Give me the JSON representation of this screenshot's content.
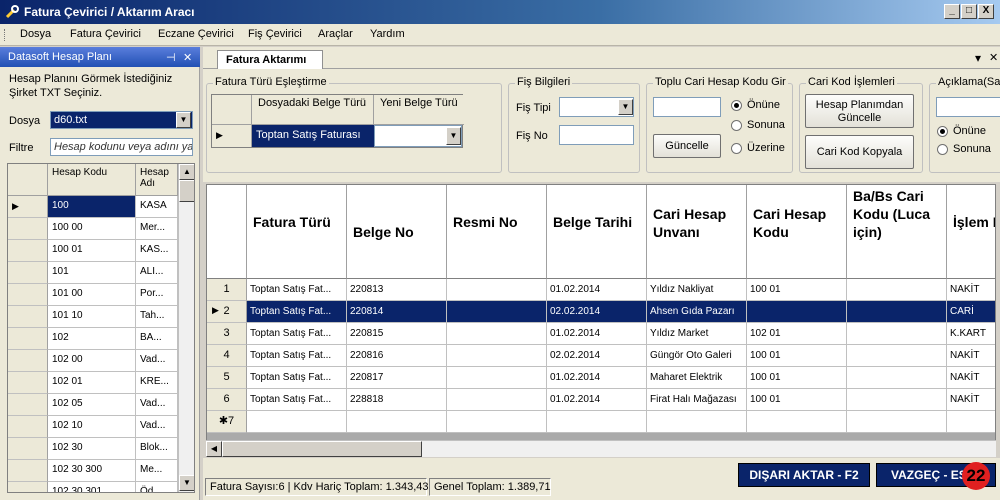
{
  "window": {
    "title": "Fatura Çevirici / Aktarım Aracı",
    "minimize": "_",
    "maximize": "□",
    "close": "X"
  },
  "menu": [
    "Dosya",
    "Fatura Çevirici",
    "Eczane Çevirici",
    "Fiş Çevirici",
    "Araçlar",
    "Yardım"
  ],
  "left_panel": {
    "title": "Datasoft Hesap Planı",
    "pin": "⊣",
    "close": "✕",
    "instruction_line1": "Hesap Planını Görmek İstediğiniz",
    "instruction_line2": "Şirket TXT Seçiniz.",
    "dosya_label": "Dosya",
    "dosya_value": "d60.txt",
    "filtre_label": "Filtre",
    "filtre_placeholder": "Hesap kodunu veya adını yaz",
    "grid_headers": [
      "Hesap Kodu",
      "Hesap Adı"
    ],
    "rows": [
      {
        "code": "100",
        "name": "KASA"
      },
      {
        "code": "100 00",
        "name": "Mer..."
      },
      {
        "code": "100 01",
        "name": "KAS..."
      },
      {
        "code": "101",
        "name": "ALI..."
      },
      {
        "code": "101 00",
        "name": "Por..."
      },
      {
        "code": "101 10",
        "name": "Tah..."
      },
      {
        "code": "102",
        "name": "BA..."
      },
      {
        "code": "102 00",
        "name": "Vad..."
      },
      {
        "code": "102 01",
        "name": "KRE..."
      },
      {
        "code": "102 05",
        "name": "Vad..."
      },
      {
        "code": "102 10",
        "name": "Vad..."
      },
      {
        "code": "102 30",
        "name": "Blok..."
      },
      {
        "code": "102 30 300",
        "name": "Me..."
      },
      {
        "code": "102 30 301",
        "name": "Öd..."
      }
    ]
  },
  "tab": {
    "label": "Fatura Aktarımı",
    "dropdown": "▾",
    "close": "✕"
  },
  "groups": {
    "fatura_turu": {
      "title": "Fatura Türü Eşleştirme",
      "col1": "Dosyadaki Belge Türü",
      "col2": "Yeni Belge Türü",
      "row_value": "Toptan Satış Faturası"
    },
    "fis": {
      "title": "Fiş Bilgileri",
      "tipi_label": "Fiş Tipi",
      "no_label": "Fiş No"
    },
    "toplu": {
      "title": "Toplu Cari Hesap Kodu Gir",
      "button": "Güncelle",
      "options": [
        "Önüne",
        "Sonuna",
        "Üzerine"
      ]
    },
    "cari": {
      "title": "Cari Kod İşlemleri",
      "btn1": "Hesap Planımdan Güncelle",
      "btn2": "Cari Kod Kopyala"
    },
    "aciklama": {
      "title": "Açıklama(Sa",
      "options": [
        "Önüne",
        "Sonuna"
      ]
    }
  },
  "grid": {
    "headers": [
      "Fatura Türü",
      "Belge No",
      "Resmi No",
      "Belge Tarihi",
      "Cari Hesap Unvanı",
      "Cari Hesap Kodu",
      "Ba/Bs Cari Kodu (Luca için)",
      "İşlem Dövizi"
    ],
    "rows": [
      {
        "n": "1",
        "tur": "Toptan Satış Fat...",
        "belge": "220813",
        "resmi": "",
        "tarih": "01.02.2014",
        "unvan": "Yıldız Nakliyat",
        "kod": "100 01",
        "babs": "",
        "doviz": "NAKİT"
      },
      {
        "n": "2",
        "tur": "Toptan Satış Fat...",
        "belge": "220814",
        "resmi": "",
        "tarih": "02.02.2014",
        "unvan": "Ahsen Gıda Pazarı",
        "kod": "",
        "babs": "",
        "doviz": "CARİ"
      },
      {
        "n": "3",
        "tur": "Toptan Satış Fat...",
        "belge": "220815",
        "resmi": "",
        "tarih": "01.02.2014",
        "unvan": "Yıldız Market",
        "kod": "102 01",
        "babs": "",
        "doviz": "K.KART"
      },
      {
        "n": "4",
        "tur": "Toptan Satış Fat...",
        "belge": "220816",
        "resmi": "",
        "tarih": "02.02.2014",
        "unvan": "Güngör Oto Galeri",
        "kod": "100 01",
        "babs": "",
        "doviz": "NAKİT"
      },
      {
        "n": "5",
        "tur": "Toptan Satış Fat...",
        "belge": "220817",
        "resmi": "",
        "tarih": "01.02.2014",
        "unvan": "Maharet Elektrik",
        "kod": "100 01",
        "babs": "",
        "doviz": "NAKİT"
      },
      {
        "n": "6",
        "tur": "Toptan Satış Fat...",
        "belge": "228818",
        "resmi": "",
        "tarih": "01.02.2014",
        "unvan": "Firat Halı Mağazası",
        "kod": "100 01",
        "babs": "",
        "doviz": "NAKİT"
      }
    ],
    "new_row_label": "✱7"
  },
  "status": {
    "fatura_sayisi": "Fatura Sayısı:6 | Kdv Hariç Toplam: 1.343,43",
    "genel_toplam": "Genel Toplam: 1.389,71",
    "export_button": "DIŞARI AKTAR - F2",
    "cancel_button": "VAZGEÇ - ES",
    "badge": "22"
  },
  "colors": {
    "selection": "#0a246a",
    "badge": "#e02020"
  }
}
